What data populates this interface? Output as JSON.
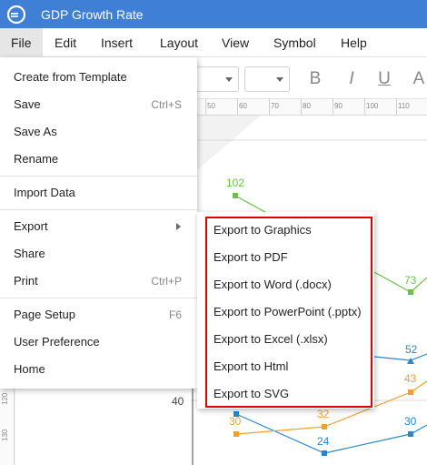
{
  "app": {
    "title": "GDP Growth Rate"
  },
  "menubar": [
    "File",
    "Edit",
    "Insert",
    "Layout",
    "View",
    "Symbol",
    "Help"
  ],
  "toolbar": {
    "icons": [
      "bold-icon",
      "italic-icon",
      "underline-icon",
      "font-color-icon"
    ],
    "labels": [
      "B",
      "I",
      "U",
      "A"
    ]
  },
  "rulers": {
    "horizontal": [
      "50",
      "60",
      "70",
      "80",
      "90",
      "100",
      "110"
    ],
    "vertical": [
      "120",
      "130"
    ]
  },
  "file_menu": {
    "items": [
      {
        "label": "Create from Template",
        "shortcut": ""
      },
      {
        "label": "Save",
        "shortcut": "Ctrl+S"
      },
      {
        "label": "Save As",
        "shortcut": ""
      },
      {
        "label": "Rename",
        "shortcut": ""
      },
      {
        "label": "Import Data",
        "shortcut": ""
      },
      {
        "label": "Export",
        "shortcut": ""
      },
      {
        "label": "Share",
        "shortcut": ""
      },
      {
        "label": "Print",
        "shortcut": "Ctrl+P"
      },
      {
        "label": "Page Setup",
        "shortcut": "F6"
      },
      {
        "label": "User Preference",
        "shortcut": ""
      },
      {
        "label": "Home",
        "shortcut": ""
      }
    ]
  },
  "export_submenu": {
    "items": [
      "Export to Graphics",
      "Export to PDF",
      "Export to Word (.docx)",
      "Export to PowerPoint (.pptx)",
      "Export to Excel (.xlsx)",
      "Export to Html",
      "Export to SVG"
    ],
    "highlight_color": "#e00000"
  },
  "colors": {
    "titlebar": "#3f7fd6",
    "green_series": "#6cc04a",
    "blue_series": "#2a86c8",
    "orange_series": "#f0a030"
  },
  "chart_data": {
    "type": "line",
    "ylabel": "",
    "yticks": [
      "40"
    ],
    "visible_labels": {
      "green": [
        "102",
        "73"
      ],
      "blue": [
        "52",
        "24",
        "30"
      ],
      "orange": [
        "43",
        "30",
        "32"
      ]
    }
  }
}
